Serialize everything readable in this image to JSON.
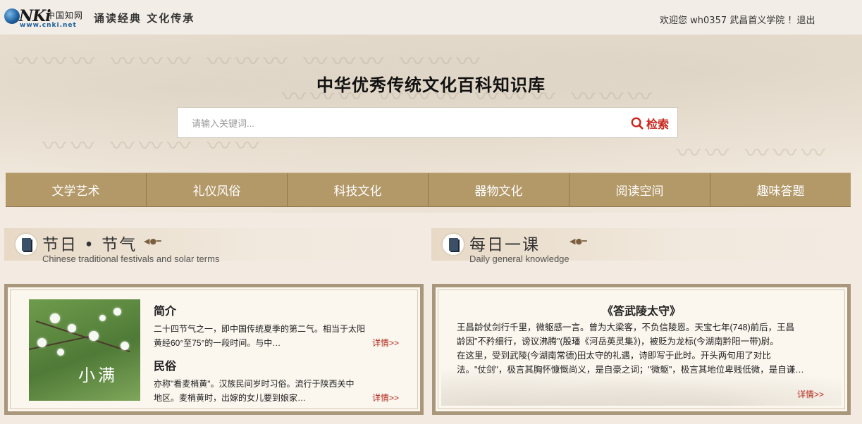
{
  "header": {
    "logo_text": "NKi",
    "logo_cn": "中国知网",
    "logo_url": "www.cnki.net",
    "slogan": "诵读经典  文化传承",
    "welcome_prefix": "欢迎您",
    "username": "wh0357",
    "institution": "武昌首义学院",
    "separator": "！",
    "logout_label": "退出"
  },
  "hero": {
    "title": "中华优秀传统文化百科知识库",
    "search_placeholder": "请输入关键词...",
    "search_button": "检索"
  },
  "nav": {
    "items": [
      {
        "label": "文学艺术"
      },
      {
        "label": "礼仪风俗"
      },
      {
        "label": "科技文化"
      },
      {
        "label": "器物文化"
      },
      {
        "label": "阅读空间"
      },
      {
        "label": "趣味答题"
      }
    ]
  },
  "festivals": {
    "title_cn": "节日 • 节气",
    "title_en": "Chinese traditional festivals and solar terms",
    "image_caption": "小满",
    "intro_heading": "简介",
    "intro_lines": [
      "二十四节气之一，即中国传统夏季的第二气。相当于太阳",
      "黄经60°至75°的一段时间。与中…"
    ],
    "intro_more": "详情>>",
    "custom_heading": "民俗",
    "custom_lines": [
      "亦称\"看麦梢黄\"。汉族民间岁时习俗。流行于陕西关中",
      "地区。麦梢黄时，出嫁的女儿要到娘家…"
    ],
    "custom_more": "详情>>"
  },
  "daily": {
    "title_cn": "每日一课",
    "title_en": "Daily general knowledge",
    "poem_title": "《答武陵太守》",
    "lines": [
      "王昌龄仗剑行千里，微躯感一言。曾为大梁客，不负信陵恩。天宝七年(748)前后，王昌",
      "龄因\"不矜细行，谤议沸腾\"(殷璠《河岳英灵集》)，被贬为龙标(今湖南黔阳一带)尉。",
      "在这里，受到武陵(今湖南常德)田太守的礼遇，诗即写于此时。开头两句用了对比",
      "法。\"仗剑\"，极言其胸怀慷慨尚义，是自豪之词；\"微躯\"，极言其地位卑贱低微，是自谦…"
    ],
    "more": "详情>>"
  }
}
